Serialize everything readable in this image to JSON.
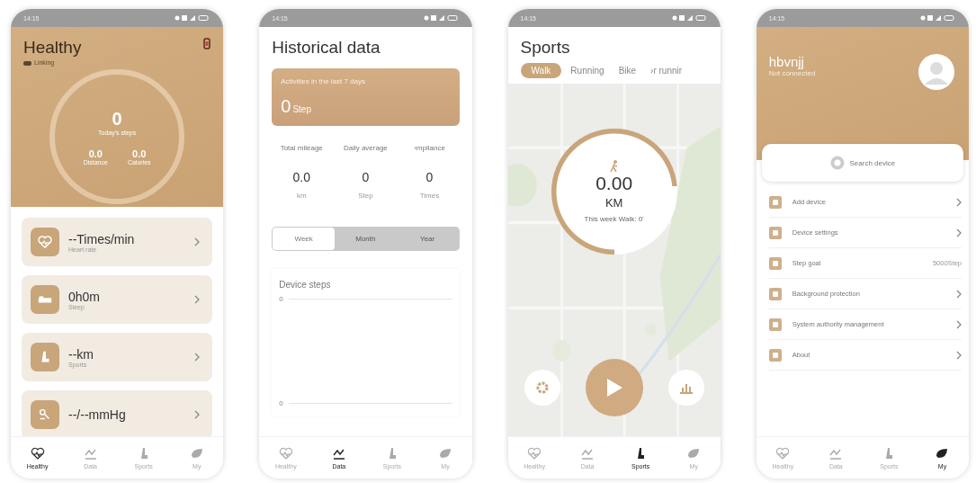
{
  "phones": [
    {
      "kind": "health",
      "status_time": "14:15",
      "title": "Healthy",
      "subtitle": "Linking",
      "steps": "0",
      "steps_label": "Today's steps",
      "stats": [
        {
          "value": "0.0",
          "label": "Distance"
        },
        {
          "value": "0.0",
          "label": "Calories"
        }
      ],
      "cards": [
        {
          "kind": "heart",
          "value": "--Times/min",
          "label": "Heart rate"
        },
        {
          "kind": "bed",
          "value": "0h0m",
          "label": "Sleep"
        },
        {
          "kind": "runner",
          "value": "--km",
          "label": "Sports"
        },
        {
          "kind": "pressure",
          "value": "--/--mmHg"
        }
      ],
      "nav": [
        {
          "label": "Healthy",
          "selected": true
        },
        {
          "label": "Data",
          "selected": false
        },
        {
          "label": "Sports",
          "selected": false
        },
        {
          "label": "My",
          "selected": false
        }
      ]
    },
    {
      "kind": "history",
      "status_time": "14:15",
      "title": "Historical data",
      "summary_label": "Activities in the last 7 days",
      "summary_value": "0",
      "summary_unit": "Step",
      "stats": [
        {
          "label": "Total mileage",
          "value": "0.0",
          "unit": "km"
        },
        {
          "label": "Daily average",
          "value": "0",
          "unit": "Step"
        },
        {
          "label": "›mpliance",
          "value": "0",
          "unit": "Times"
        }
      ],
      "periods": [
        {
          "label": "Week",
          "selected": true
        },
        {
          "label": "Month",
          "selected": false
        },
        {
          "label": "Year",
          "selected": false
        }
      ],
      "chart": {
        "title": "Device steps",
        "y_labels": [
          "0",
          "0"
        ]
      },
      "nav": [
        {
          "label": "Healthy",
          "selected": false
        },
        {
          "label": "Data",
          "selected": true
        },
        {
          "label": "Sports",
          "selected": false
        },
        {
          "label": "My",
          "selected": false
        }
      ]
    },
    {
      "kind": "sports",
      "status_time": "14:15",
      "title": "Sports",
      "modes": [
        {
          "label": "Walk",
          "selected": true
        },
        {
          "label": "Running",
          "selected": false
        },
        {
          "label": "Bike",
          "selected": false
        },
        {
          "label": "›r runnir",
          "selected": false
        }
      ],
      "distance": "0.00",
      "unit": "KM",
      "week_label": "This week Walk: 0'",
      "nav": [
        {
          "label": "Healthy",
          "selected": false
        },
        {
          "label": "Data",
          "selected": false
        },
        {
          "label": "Sports",
          "selected": true
        },
        {
          "label": "My",
          "selected": false
        }
      ]
    },
    {
      "kind": "profile",
      "status_time": "14:15",
      "name": "hbvnjj",
      "subtitle": "Not connected",
      "search": "Search device",
      "menu": [
        {
          "kind": "link",
          "label": "Add device"
        },
        {
          "kind": "link",
          "label": "Device settings"
        },
        {
          "kind": "value",
          "label": "Step goal",
          "value": "5000Step"
        },
        {
          "kind": "link",
          "label": "Background protection"
        },
        {
          "kind": "link",
          "label": "System authority management"
        },
        {
          "kind": "link",
          "label": "About"
        }
      ],
      "nav": [
        {
          "label": "Healthy",
          "selected": false
        },
        {
          "label": "Data",
          "selected": false
        },
        {
          "label": "Sports",
          "selected": false
        },
        {
          "label": "My",
          "selected": true
        }
      ]
    }
  ]
}
